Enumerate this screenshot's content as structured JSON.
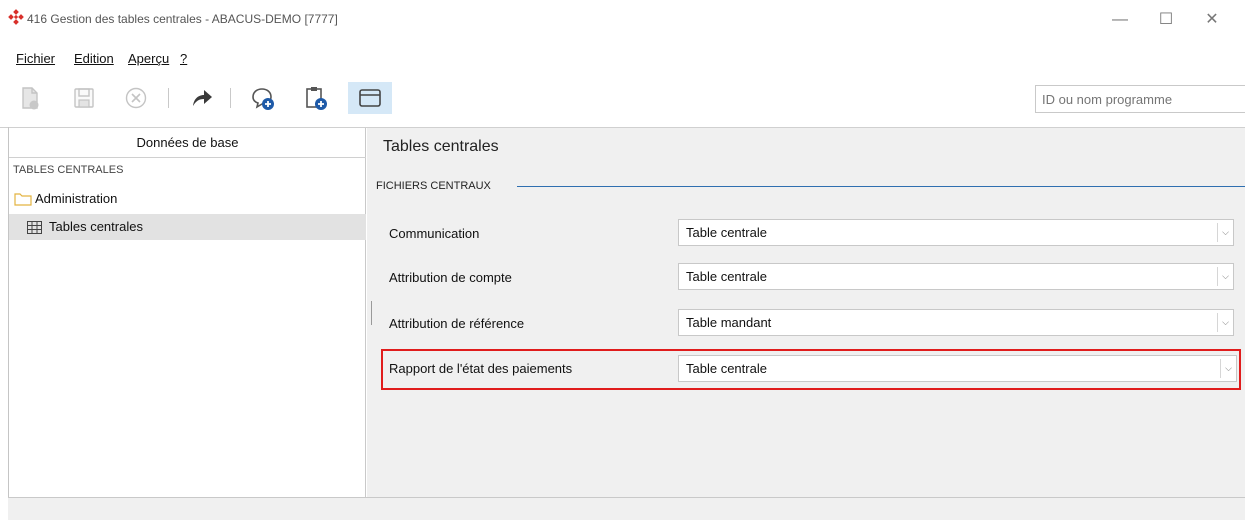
{
  "window": {
    "title": "416 Gestion des tables centrales - ABACUS-DEMO [7777]",
    "minimize": "—",
    "maximize": "☐",
    "close": "✕"
  },
  "menu": [
    {
      "label": "Fichier"
    },
    {
      "label": "Edition"
    },
    {
      "label": "Aperçu"
    },
    {
      "label": "?"
    }
  ],
  "toolbar": {
    "icons": [
      "new-document-icon",
      "save-icon",
      "cancel-icon",
      "forward-icon",
      "comment-add-icon",
      "clipboard-add-icon",
      "window-icon"
    ],
    "search_placeholder": "ID ou nom programme"
  },
  "left": {
    "header": "Données de base",
    "section": "TABLES CENTRALES",
    "tree": [
      {
        "label": "Administration",
        "icon": "folder-icon"
      },
      {
        "label": "Tables centrales",
        "icon": "table-grid-icon",
        "selected": true
      }
    ]
  },
  "right": {
    "title": "Tables centrales",
    "section": "FICHIERS CENTRAUX",
    "fields": [
      {
        "label": "Communication",
        "value": "Table centrale"
      },
      {
        "label": "Attribution de compte",
        "value": "Table centrale"
      },
      {
        "label": "Attribution de référence",
        "value": "Table mandant"
      },
      {
        "label": "Rapport de l'état des paiements",
        "value": "Table centrale",
        "highlighted": true
      }
    ]
  },
  "colors": {
    "accent_line": "#2f6fb0",
    "highlight": "#e01c1c",
    "logo": "#d9302b",
    "selected_row": "#e2e2e2"
  }
}
